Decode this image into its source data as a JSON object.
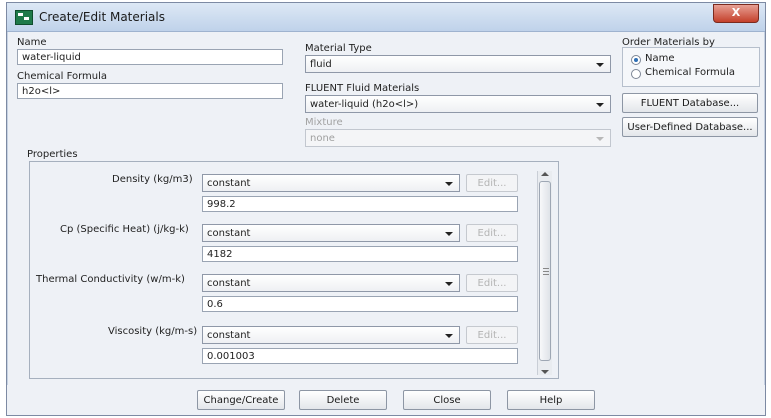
{
  "window": {
    "title": "Create/Edit Materials",
    "close_label": "X"
  },
  "name": {
    "label": "Name",
    "value": "water-liquid"
  },
  "chemical_formula": {
    "label": "Chemical Formula",
    "value": "h2o<l>"
  },
  "material_type": {
    "label": "Material Type",
    "value": "fluid"
  },
  "fluent_materials": {
    "label": "FLUENT Fluid Materials",
    "value": "water-liquid (h2o<l>)"
  },
  "mixture": {
    "label": "Mixture",
    "value": "none"
  },
  "order": {
    "label": "Order Materials by",
    "options": [
      {
        "label": "Name",
        "selected": true
      },
      {
        "label": "Chemical Formula",
        "selected": false
      }
    ]
  },
  "buttons_right": {
    "fluent_db": "FLUENT Database...",
    "user_db": "User-Defined Database..."
  },
  "properties": {
    "label": "Properties",
    "edit_label": "Edit...",
    "items": [
      {
        "label": "Density (kg/m3)",
        "method": "constant",
        "value": "998.2"
      },
      {
        "label": "Cp (Specific Heat) (j/kg-k)",
        "method": "constant",
        "value": "4182"
      },
      {
        "label": "Thermal Conductivity (w/m-k)",
        "method": "constant",
        "value": "0.6"
      },
      {
        "label": "Viscosity (kg/m-s)",
        "method": "constant",
        "value": "0.001003"
      }
    ]
  },
  "bottom_buttons": {
    "change_create": "Change/Create",
    "delete": "Delete",
    "close": "Close",
    "help": "Help"
  },
  "icons": [
    "app-icon",
    "close-icon",
    "dropdown-arrow-icon",
    "scroll-up-icon",
    "scroll-down-icon"
  ]
}
